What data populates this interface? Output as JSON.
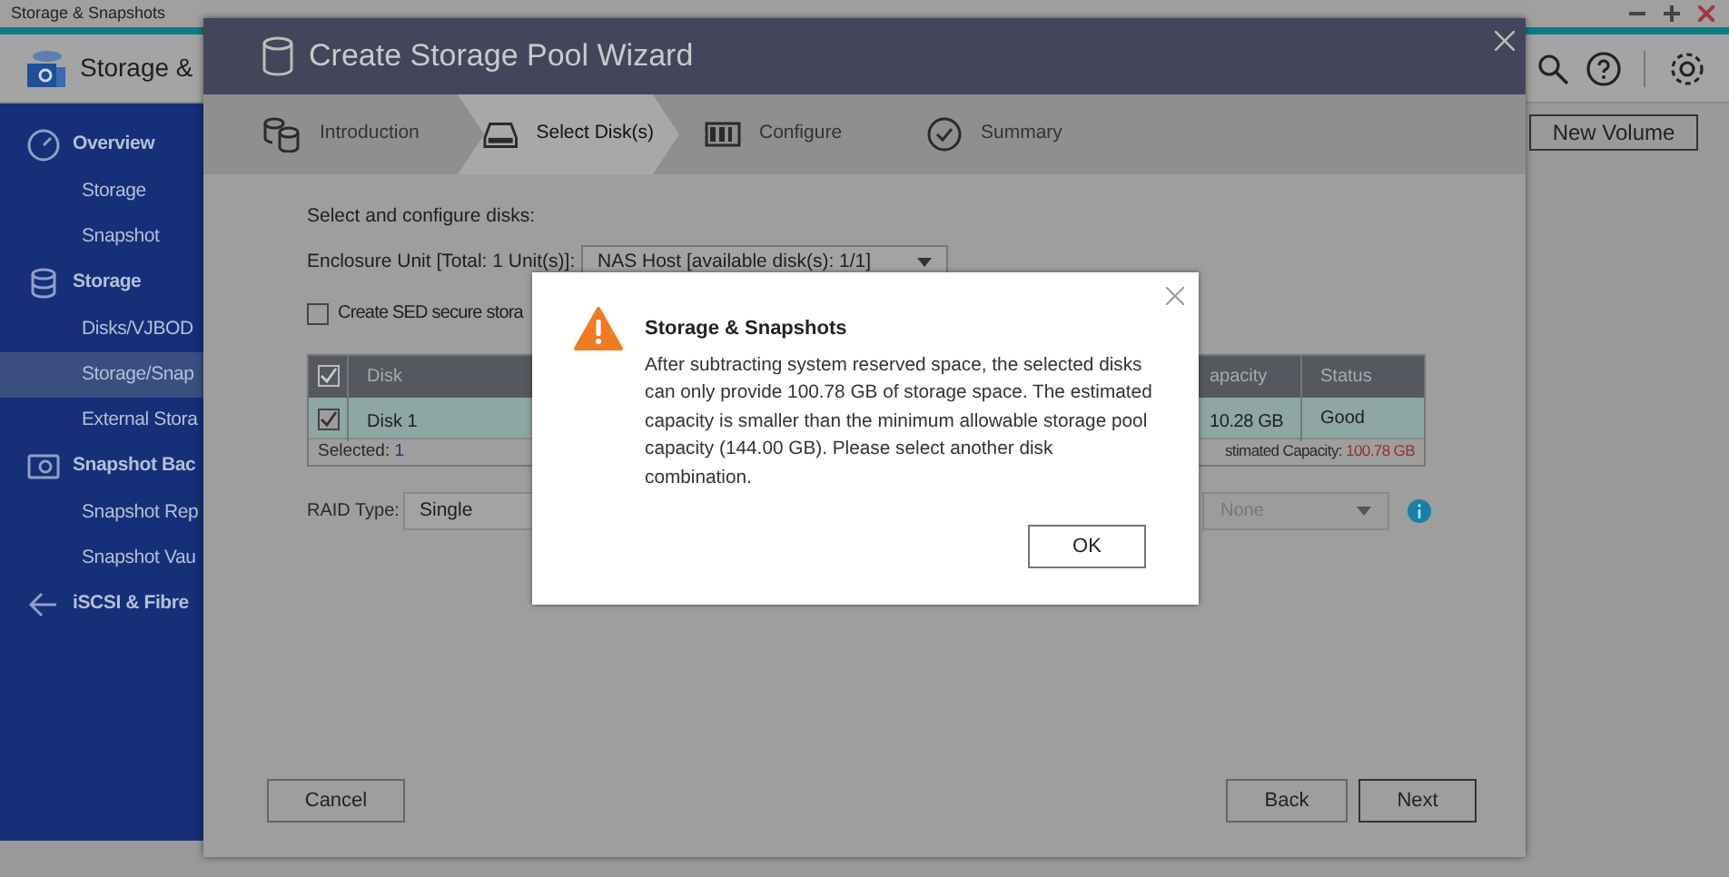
{
  "window": {
    "title": "Storage & Snapshots"
  },
  "app": {
    "title": "Storage &",
    "new_volume_button": "New Volume"
  },
  "sidebar": {
    "items": [
      {
        "label": "Overview",
        "kind": "section",
        "selected": false
      },
      {
        "label": "Storage",
        "kind": "item",
        "selected": false
      },
      {
        "label": "Snapshot",
        "kind": "item",
        "selected": false
      },
      {
        "label": "Storage",
        "kind": "section",
        "selected": false
      },
      {
        "label": "Disks/VJBOD",
        "kind": "item",
        "selected": false
      },
      {
        "label": "Storage/Snap",
        "kind": "item",
        "selected": true
      },
      {
        "label": "External Stora",
        "kind": "item",
        "selected": false
      },
      {
        "label": "Snapshot Bac",
        "kind": "section",
        "selected": false
      },
      {
        "label": "Snapshot Rep",
        "kind": "item",
        "selected": false
      },
      {
        "label": "Snapshot Vau",
        "kind": "item",
        "selected": false
      },
      {
        "label": "iSCSI & Fibre",
        "kind": "section",
        "selected": false
      }
    ]
  },
  "wizard": {
    "title": "Create Storage Pool Wizard",
    "steps": [
      {
        "label": "Introduction",
        "selected": false
      },
      {
        "label": "Select Disk(s)",
        "selected": true
      },
      {
        "label": "Configure",
        "selected": false
      },
      {
        "label": "Summary",
        "selected": false
      }
    ],
    "heading": "Select and configure disks:",
    "enclosure_label": "Enclosure Unit [Total: 1 Unit(s)]:",
    "enclosure_value": "NAS Host [available disk(s): 1/1]",
    "sed_checkbox": {
      "label": "Create SED secure stora",
      "checked": false
    },
    "table": {
      "columns": [
        "Disk",
        "apacity",
        "Status"
      ],
      "header_checked": true,
      "rows": [
        {
          "disk": "Disk 1",
          "capacity": "10.28 GB",
          "status": "Good",
          "checked": true,
          "selected": true
        }
      ],
      "selected_label": "Selected:",
      "selected_count": "1",
      "estimated_label": "stimated Capacity:",
      "estimated_value": "100.78 GB"
    },
    "raid_label": "RAID Type:",
    "raid_value": "Single",
    "second_select": {
      "value": "None",
      "disabled": true
    },
    "buttons": {
      "cancel": "Cancel",
      "back": "Back",
      "next": "Next"
    }
  },
  "alert": {
    "title": "Storage & Snapshots",
    "message": "After subtracting system reserved space, the selected disks can only provide 100.78 GB of storage space. The estimated capacity is smaller than the minimum allowable storage pool capacity (144.00 GB). Please select another disk combination.",
    "ok": "OK"
  }
}
